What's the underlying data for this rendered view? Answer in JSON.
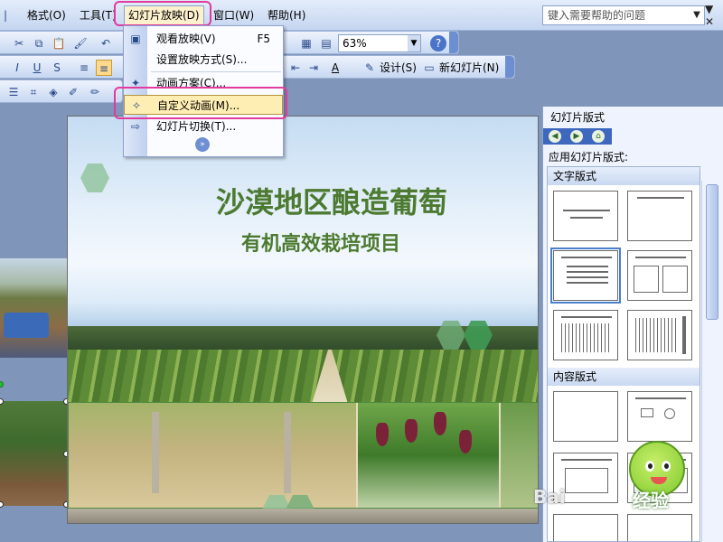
{
  "menubar": {
    "items": [
      {
        "label": "格式(O)"
      },
      {
        "label": "工具(T)"
      },
      {
        "label": "幻灯片放映(D)"
      },
      {
        "label": "窗口(W)"
      },
      {
        "label": "帮助(H)"
      }
    ],
    "help_placeholder": "键入需要帮助的问题"
  },
  "toolbar": {
    "zoom": "63%",
    "design_label": "设计(S)",
    "new_slide_label": "新幻灯片(N)"
  },
  "dropdown": {
    "items": [
      {
        "label": "观看放映(V)",
        "shortcut": "F5",
        "icon": "play-slideshow-icon"
      },
      {
        "label": "设置放映方式(S)...",
        "shortcut": "",
        "icon": ""
      },
      {
        "label": "动画方案(C)...",
        "shortcut": "",
        "icon": "animation-scheme-icon"
      },
      {
        "label": "自定义动画(M)...",
        "shortcut": "",
        "icon": "custom-animation-icon"
      },
      {
        "label": "幻灯片切换(T)...",
        "shortcut": "",
        "icon": "slide-transition-icon"
      }
    ],
    "active_index": 3
  },
  "slide": {
    "title": "沙漠地区酿造葡萄",
    "subtitle": "有机高效栽培项目"
  },
  "task_pane": {
    "title": "幻灯片版式",
    "apply_label": "应用幻灯片版式:",
    "section_text": "文字版式",
    "section_content": "内容版式"
  },
  "watermark": {
    "text": "Bai",
    "text2": "经验"
  },
  "colors": {
    "accent_highlight": "#e23a9e",
    "title_green": "#4c7a30",
    "menu_bg": "#c5d6f1"
  }
}
